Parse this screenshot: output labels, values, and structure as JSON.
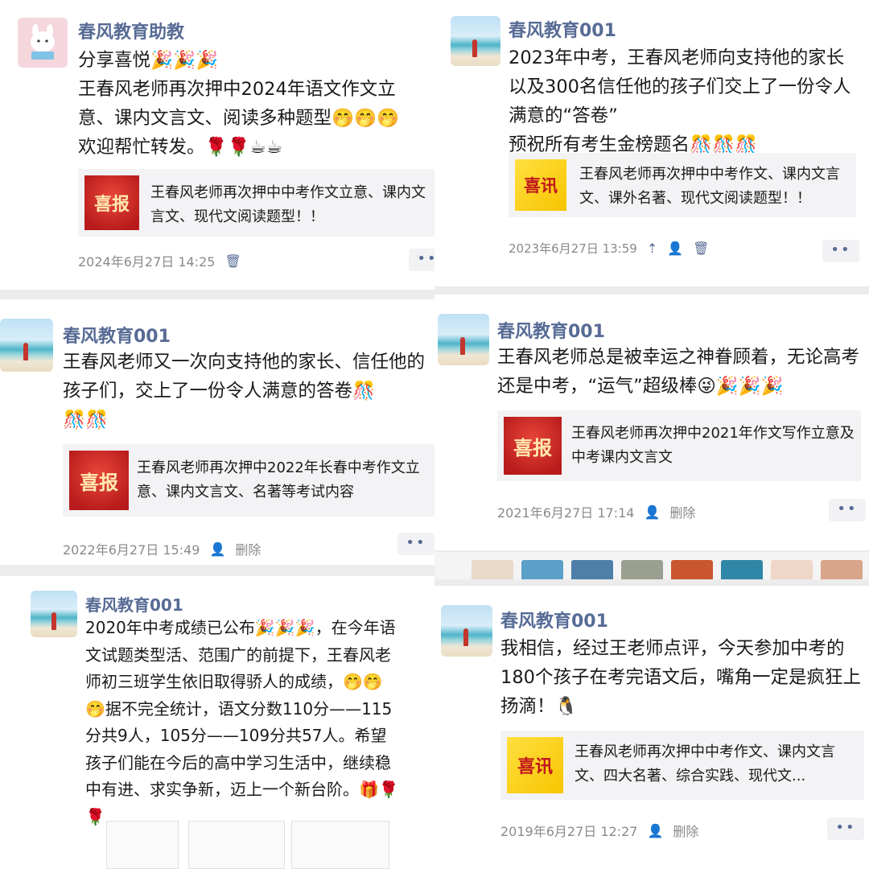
{
  "posts": [
    {
      "name": "春风教育助教",
      "text": "分享喜悦🎉🎉🎉\n王春风老师再次押中2024年语文作文立意、课内文言文、阅读多种题型🤭🤭🤭\n欢迎帮忙转发。🌹🌹☕☕",
      "link_title": "王春风老师再次押中中考作文立意、课内文言文、现代文阅读题型！！",
      "thumb_text": "喜报",
      "time": "2024年6月27日 14:25",
      "action": "",
      "icons": [
        "delete-icon"
      ]
    },
    {
      "name": "春风教育001",
      "text": "2023年中考，王春风老师向支持他的家长以及300名信任他的孩子们交上了一份令人满意的“答卷”\n预祝所有考生金榜题名🎊🎊🎊",
      "link_title": "王春风老师再次押中中考作文、课内文言文、课外名著、现代文阅读题型！！",
      "thumb_text": "喜讯",
      "time": "2023年6月27日 13:59",
      "action": "",
      "icons": [
        "pin-icon",
        "people-icon",
        "delete-icon"
      ]
    },
    {
      "name": "春风教育001",
      "text": "王春风老师又一次向支持他的家长、信任他的孩子们，交上了一份令人满意的答卷🎊\n🎊🎊",
      "link_title": "王春风老师再次押中2022年长春中考作文立意、课内文言文、名著等考试内容",
      "thumb_text": "喜报",
      "time": "2022年6月27日 15:49",
      "action": "删除",
      "icons": [
        "people-icon"
      ]
    },
    {
      "name": "春风教育001",
      "text": "王春风老师总是被幸运之神眷顾着，无论高考还是中考，“运气”超级棒😜🎉🎉🎉",
      "link_title": "王春风老师再次押中2021年作文写作立意及中考课内文言文",
      "thumb_text": "喜报",
      "time": "2021年6月27日 17:14",
      "action": "删除",
      "icons": [
        "people-icon"
      ]
    },
    {
      "name": "春风教育001",
      "text": "2020年中考成绩已公布🎉🎉🎉，在今年语文试题类型活、范围广的前提下，王春风老师初三班学生依旧取得骄人的成绩，🤭🤭🤭据不完全统计，语文分数110分——115分共9人，105分——109分共57人。希望孩子们能在今后的高中学习生活中，继续稳中有进、求实争新，迈上一个新台阶。🎁🌹🌹",
      "link_title": "",
      "thumb_text": "",
      "time": "",
      "action": "",
      "icons": []
    },
    {
      "name": "春风教育001",
      "text": "我相信，经过王老师点评，今天参加中考的180个孩子在考完语文后，嘴角一定是疯狂上扬滴！🐧",
      "link_title": "王春风老师再次押中中考作文、课内文言文、四大名著、综合实践、现代文...",
      "thumb_text": "喜讯",
      "time": "2019年6月27日 12:27",
      "action": "删除",
      "icons": [
        "people-icon"
      ]
    }
  ],
  "more_label": "••",
  "colors": {
    "name": "#576b95",
    "text": "#1a1a1a",
    "meta": "#8a8a8a",
    "card": "#f3f3f5"
  }
}
